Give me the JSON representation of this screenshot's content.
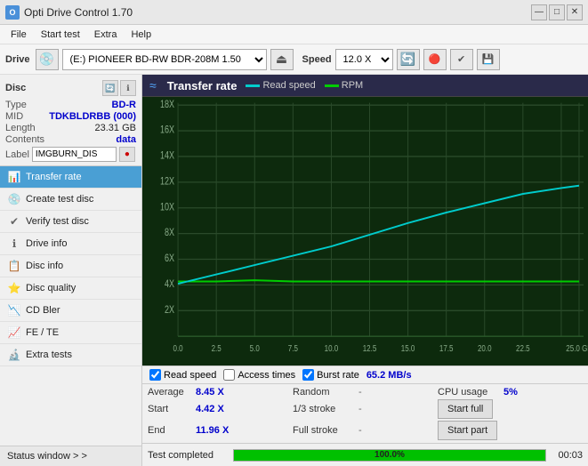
{
  "app": {
    "title": "Opti Drive Control 1.70",
    "title_icon": "O"
  },
  "title_buttons": {
    "minimize": "—",
    "maximize": "□",
    "close": "✕"
  },
  "menu": {
    "items": [
      "File",
      "Start test",
      "Extra",
      "Help"
    ]
  },
  "toolbar": {
    "drive_label": "Drive",
    "drive_value": "(E:)  PIONEER BD-RW   BDR-208M 1.50",
    "speed_label": "Speed",
    "speed_value": "12.0 X ∨"
  },
  "disc": {
    "section_title": "Disc",
    "rows": [
      {
        "label": "Type",
        "value": "BD-R",
        "style": "blue"
      },
      {
        "label": "MID",
        "value": "TDKBLDRBB (000)",
        "style": "blue"
      },
      {
        "label": "Length",
        "value": "23.31 GB",
        "style": "black"
      },
      {
        "label": "Contents",
        "value": "data",
        "style": "blue"
      }
    ],
    "label_field": {
      "label": "Label",
      "value": "IMGBURN_DIS"
    }
  },
  "nav": {
    "items": [
      {
        "id": "transfer-rate",
        "label": "Transfer rate",
        "icon": "📊",
        "active": true
      },
      {
        "id": "create-test-disc",
        "label": "Create test disc",
        "icon": "💿"
      },
      {
        "id": "verify-test-disc",
        "label": "Verify test disc",
        "icon": "✔"
      },
      {
        "id": "drive-info",
        "label": "Drive info",
        "icon": "ℹ"
      },
      {
        "id": "disc-info",
        "label": "Disc info",
        "icon": "📋"
      },
      {
        "id": "disc-quality",
        "label": "Disc quality",
        "icon": "⭐"
      },
      {
        "id": "cd-bler",
        "label": "CD Bler",
        "icon": "📉"
      },
      {
        "id": "fe-te",
        "label": "FE / TE",
        "icon": "📈"
      },
      {
        "id": "extra-tests",
        "label": "Extra tests",
        "icon": "🔬"
      }
    ]
  },
  "status_window": {
    "label": "Status window > >"
  },
  "chart": {
    "title": "Transfer rate",
    "icon": "≈",
    "legend": {
      "read_speed_label": "Read speed",
      "read_speed_color": "#00cccc",
      "rpm_label": "RPM",
      "rpm_color": "#00cc00"
    },
    "y_axis": {
      "labels": [
        "18X",
        "16X",
        "14X",
        "12X",
        "10X",
        "8X",
        "6X",
        "4X",
        "2X"
      ]
    },
    "x_axis": {
      "labels": [
        "0.0",
        "2.5",
        "5.0",
        "7.5",
        "10.0",
        "12.5",
        "15.0",
        "17.5",
        "20.0",
        "22.5",
        "25.0 GB"
      ]
    }
  },
  "chart_controls": {
    "read_speed_checked": true,
    "read_speed_label": "Read speed",
    "access_times_checked": false,
    "access_times_label": "Access times",
    "burst_rate_checked": true,
    "burst_rate_label": "Burst rate",
    "burst_rate_value": "65.2 MB/s"
  },
  "stats": {
    "row1": {
      "avg_label": "Average",
      "avg_value": "8.45 X",
      "random_label": "Random",
      "random_value": "-",
      "cpu_label": "CPU usage",
      "cpu_value": "5%"
    },
    "row2": {
      "start_label": "Start",
      "start_value": "4.42 X",
      "stroke13_label": "1/3 stroke",
      "stroke13_value": "-",
      "start_full_btn": "Start full"
    },
    "row3": {
      "end_label": "End",
      "end_value": "11.96 X",
      "full_stroke_label": "Full stroke",
      "full_stroke_value": "-",
      "start_part_btn": "Start part"
    }
  },
  "progress": {
    "status_text": "Test completed",
    "percent": 100,
    "percent_display": "100.0%",
    "time_display": "00:03"
  },
  "colors": {
    "accent_blue": "#4a9fd4",
    "grid_bg": "#1a3a1a",
    "read_speed_line": "#00cccc",
    "rpm_line": "#00cc00",
    "active_nav_bg": "#4a9fd4"
  }
}
